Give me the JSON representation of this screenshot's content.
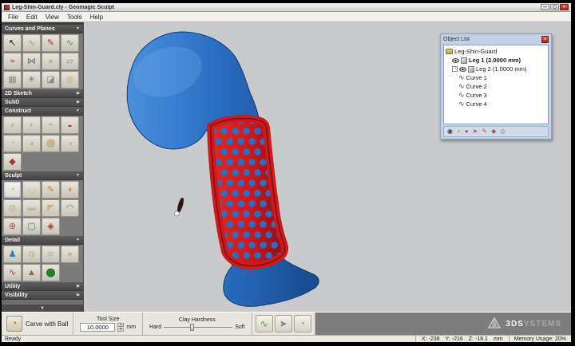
{
  "window": {
    "title": "Leg-Shin-Guard.cly - Geomagic Sculpt",
    "controls": [
      {
        "name": "minimize-button",
        "glyph": "—"
      },
      {
        "name": "maximize-button",
        "glyph": "▢"
      },
      {
        "name": "close-button",
        "glyph": "×"
      }
    ]
  },
  "menu": {
    "items": [
      "File",
      "Edit",
      "View",
      "Tools",
      "Help"
    ]
  },
  "toolbox": {
    "sections": [
      {
        "label": "Curves and Planes",
        "expanded": true,
        "chevron": "▼",
        "icons": [
          {
            "name": "select-tool",
            "glyph": "↖",
            "color": "#111111"
          },
          {
            "name": "draw-curve-tool",
            "glyph": "∿",
            "color": "#b9a23c"
          },
          {
            "name": "edit-curve-tool",
            "glyph": "✎",
            "color": "#b03030"
          },
          {
            "name": "offset-curve-tool",
            "glyph": "∿",
            "color": "#3f9a3f"
          },
          {
            "name": "sketch-curve-tool",
            "glyph": "≈",
            "color": "#b03030"
          },
          {
            "name": "mirror-curves-tool",
            "glyph": "⋈",
            "color": "#6a6a6a"
          },
          {
            "name": "sphere-primitive-tool",
            "glyph": "●",
            "color": "#c9b489"
          },
          {
            "name": "plane-tool",
            "glyph": "▱",
            "color": "#8a8a8a"
          },
          {
            "name": "grid-plane-tool",
            "glyph": "▦",
            "color": "#8a8a8a"
          },
          {
            "name": "curve-snap-tool",
            "glyph": "✳",
            "color": "#777777"
          },
          {
            "name": "section-plane-tool",
            "glyph": "◪",
            "color": "#8a8a8a"
          },
          {
            "name": "ball-primitive-tool",
            "glyph": "◍",
            "color": "#c9b489"
          }
        ]
      },
      {
        "label": "2D Sketch",
        "expanded": false,
        "chevron": "▶",
        "icons": []
      },
      {
        "label": "SubD",
        "expanded": false,
        "chevron": "▶",
        "icons": []
      },
      {
        "label": "Construct",
        "expanded": true,
        "chevron": "▼",
        "icons": [
          {
            "name": "add-clay-tool",
            "glyph": "◖",
            "color": "#c9b489"
          },
          {
            "name": "extrude-clay-tool",
            "glyph": "◗",
            "color": "#c9b489"
          },
          {
            "name": "round-clay-tool",
            "glyph": "◓",
            "color": "#c9b489"
          },
          {
            "name": "cut-clay-tool",
            "glyph": "◒",
            "color": "#b03030"
          },
          {
            "name": "offset-clay-tool",
            "glyph": "◔",
            "color": "#c9b489"
          },
          {
            "name": "inflate-clay-tool",
            "glyph": "◕",
            "color": "#c9b489"
          },
          {
            "name": "merge-clay-tool",
            "glyph": "⬤",
            "color": "#c9b489"
          },
          {
            "name": "shell-clay-tool",
            "glyph": "◑",
            "color": "#c9b489"
          },
          {
            "name": "wire-cut-tool",
            "glyph": "◆",
            "color": "#b03030"
          }
        ]
      },
      {
        "label": "Sculpt",
        "expanded": true,
        "chevron": "▼",
        "icons": [
          {
            "name": "carve-with-ball-tool",
            "glyph": "◔",
            "color": "#c9b489",
            "selected": true
          },
          {
            "name": "smooth-clay-tool",
            "glyph": "◡",
            "color": "#c9b489"
          },
          {
            "name": "hot-wax-tool",
            "glyph": "✎",
            "color": "#cf7a2a"
          },
          {
            "name": "tug-clay-tool",
            "glyph": "◖",
            "color": "#cf7a2a"
          },
          {
            "name": "emboss-ball-tool",
            "glyph": "◍",
            "color": "#c9b489"
          },
          {
            "name": "flatten-clay-tool",
            "glyph": "▬",
            "color": "#c9b489"
          },
          {
            "name": "scrape-clay-tool",
            "glyph": "◤",
            "color": "#c9b489"
          },
          {
            "name": "deform-clay-tool",
            "glyph": "◠",
            "color": "#3f9a3f"
          },
          {
            "name": "add-sphere-tool",
            "glyph": "⊕",
            "color": "#b05050"
          },
          {
            "name": "select-clay-tool",
            "glyph": "▢",
            "color": "#3f9a3f"
          },
          {
            "name": "symmetry-tool",
            "glyph": "◈",
            "color": "#b03030"
          }
        ]
      },
      {
        "label": "Detail",
        "expanded": true,
        "chevron": "▼",
        "icons": [
          {
            "name": "pose-tool",
            "glyph": "♟",
            "color": "#3a6fc0"
          },
          {
            "name": "texture-ball-tool",
            "glyph": "◍",
            "color": "#c9b489"
          },
          {
            "name": "wave-texture-tool",
            "glyph": "≋",
            "color": "#c9b489"
          },
          {
            "name": "smooth-ball-tool",
            "glyph": "●",
            "color": "#c9b489"
          },
          {
            "name": "curve-detail-tool",
            "glyph": "∿",
            "color": "#b03030"
          },
          {
            "name": "ridge-tool",
            "glyph": "▲",
            "color": "#8a6a3a"
          },
          {
            "name": "paint-tool",
            "glyph": "⬤",
            "color": "#2a7d2a"
          }
        ]
      },
      {
        "label": "Utility",
        "expanded": false,
        "chevron": "▶",
        "icons": []
      },
      {
        "label": "Visibility",
        "expanded": false,
        "chevron": "▶",
        "icons": []
      }
    ],
    "scroll_hint": "▼"
  },
  "object_list": {
    "title": "Object List",
    "close_glyph": "×",
    "items": [
      {
        "label": "Leg-Shin-Guard",
        "level": 0,
        "icon": "folder",
        "bold": false
      },
      {
        "label": "Leg 1 (2.0000 mm)",
        "level": 1,
        "icon": "piece",
        "bold": true,
        "eye": true
      },
      {
        "label": "Leg 2 (1.0000 mm)",
        "level": 1,
        "icon": "piece",
        "bold": false,
        "eye": true,
        "expander": "−"
      },
      {
        "label": "Curve 1",
        "level": 2,
        "icon": "curve",
        "bold": false
      },
      {
        "label": "Curve 2",
        "level": 2,
        "icon": "curve",
        "bold": false
      },
      {
        "label": "Curve 3",
        "level": 2,
        "icon": "curve",
        "bold": false
      },
      {
        "label": "Curve 4",
        "level": 2,
        "icon": "curve",
        "bold": false
      }
    ],
    "footer_icons": [
      {
        "name": "eye-icon",
        "glyph": "◉",
        "color": "#3a3a3a"
      },
      {
        "name": "clay-yellow-icon",
        "glyph": "●",
        "color": "#d8b84a"
      },
      {
        "name": "clay-red-icon",
        "glyph": "●",
        "color": "#c0504a"
      },
      {
        "name": "pin-a-icon",
        "glyph": "➤",
        "color": "#c05050"
      },
      {
        "name": "pin-b-icon",
        "glyph": "✎",
        "color": "#c05050"
      },
      {
        "name": "pin-c-icon",
        "glyph": "◆",
        "color": "#c05050"
      },
      {
        "name": "inspect-icon",
        "glyph": "◎",
        "color": "#8a8a8a"
      }
    ]
  },
  "bottom_toolbar": {
    "active_tool_label": "Carve with Ball",
    "active_tool_glyph": "◔",
    "tool_size_label": "Tool Size",
    "tool_size_value": "10.0000",
    "unit_label": "mm",
    "clay_hardness_label": "Clay Hardness",
    "hard_label": "Hard",
    "soft_label": "Soft",
    "buttons": [
      {
        "name": "measure-tool-button",
        "glyph": "∿",
        "color": "#3f9a3f"
      },
      {
        "name": "pin-cursor-button",
        "glyph": "➤",
        "color": "#8a7a9a"
      },
      {
        "name": "ball-view-button",
        "glyph": "◔",
        "color": "#9a9a9a"
      }
    ]
  },
  "brand": {
    "bold": "3DS",
    "light": "YSTEMS"
  },
  "status_bar": {
    "ready_label": "Ready",
    "coords": [
      {
        "label": "X:",
        "value": "-238"
      },
      {
        "label": "Y:",
        "value": "-216"
      },
      {
        "label": "Z:",
        "value": "-16.1"
      }
    ],
    "unit": "mm",
    "memory_label": "Memory Usage: 20%"
  },
  "viewport": {
    "background_color": "#c9cacb",
    "leg_color": "#2b6fc4",
    "guard_color": "#cc1a1f",
    "model_description": "leg model with perforated shin guard"
  }
}
